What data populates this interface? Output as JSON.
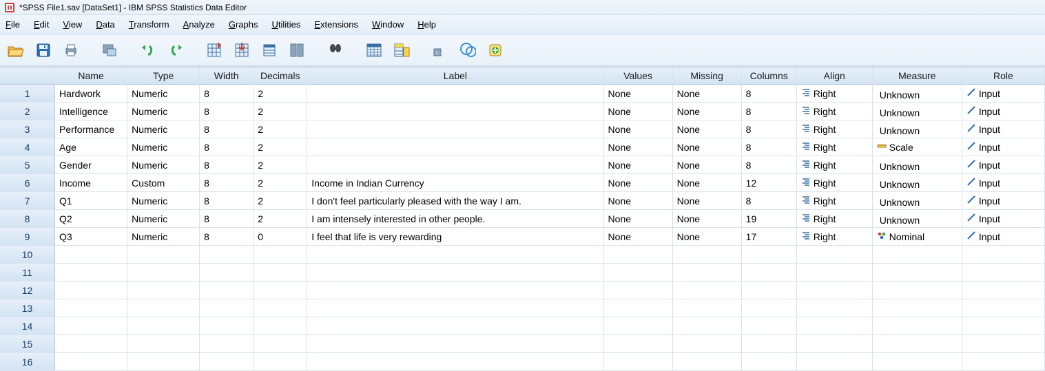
{
  "window": {
    "title": "*SPSS File1.sav [DataSet1] - IBM SPSS Statistics Data Editor"
  },
  "menu": {
    "file": "File",
    "edit": "Edit",
    "view": "View",
    "data": "Data",
    "transform": "Transform",
    "analyze": "Analyze",
    "graphs": "Graphs",
    "utilities": "Utilities",
    "extensions": "Extensions",
    "window": "Window",
    "help": "Help"
  },
  "columns": {
    "name": "Name",
    "type": "Type",
    "width": "Width",
    "decimals": "Decimals",
    "label": "Label",
    "values": "Values",
    "missing": "Missing",
    "cols": "Columns",
    "align": "Align",
    "measure": "Measure",
    "role": "Role"
  },
  "rows": [
    {
      "n": "1",
      "name": "Hardwork",
      "type": "Numeric",
      "width": "8",
      "dec": "2",
      "label": "",
      "values": "None",
      "missing": "None",
      "cols": "8",
      "align": "Right",
      "measure": "Unknown",
      "role": "Input"
    },
    {
      "n": "2",
      "name": "Intelligence",
      "type": "Numeric",
      "width": "8",
      "dec": "2",
      "label": "",
      "values": "None",
      "missing": "None",
      "cols": "8",
      "align": "Right",
      "measure": "Unknown",
      "role": "Input"
    },
    {
      "n": "3",
      "name": "Performance",
      "type": "Numeric",
      "width": "8",
      "dec": "2",
      "label": "",
      "values": "None",
      "missing": "None",
      "cols": "8",
      "align": "Right",
      "measure": "Unknown",
      "role": "Input"
    },
    {
      "n": "4",
      "name": "Age",
      "type": "Numeric",
      "width": "8",
      "dec": "2",
      "label": "",
      "values": "None",
      "missing": "None",
      "cols": "8",
      "align": "Right",
      "measure": "Scale",
      "role": "Input"
    },
    {
      "n": "5",
      "name": "Gender",
      "type": "Numeric",
      "width": "8",
      "dec": "2",
      "label": "",
      "values": "None",
      "missing": "None",
      "cols": "8",
      "align": "Right",
      "measure": "Unknown",
      "role": "Input"
    },
    {
      "n": "6",
      "name": "Income",
      "type": "Custom",
      "width": "8",
      "dec": "2",
      "label": "Income in Indian Currency",
      "values": "None",
      "missing": "None",
      "cols": "12",
      "align": "Right",
      "measure": "Unknown",
      "role": "Input"
    },
    {
      "n": "7",
      "name": "Q1",
      "type": "Numeric",
      "width": "8",
      "dec": "2",
      "label": "I don't feel particularly pleased with the way I am.",
      "values": "None",
      "missing": "None",
      "cols": "8",
      "align": "Right",
      "measure": "Unknown",
      "role": "Input"
    },
    {
      "n": "8",
      "name": "Q2",
      "type": "Numeric",
      "width": "8",
      "dec": "2",
      "label": "I am intensely interested in other people.",
      "values": "None",
      "missing": "None",
      "cols": "19",
      "align": "Right",
      "measure": "Unknown",
      "role": "Input"
    },
    {
      "n": "9",
      "name": "Q3",
      "type": "Numeric",
      "width": "8",
      "dec": "0",
      "label": "I feel that life is very rewarding",
      "values": "None",
      "missing": "None",
      "cols": "17",
      "align": "Right",
      "measure": "Nominal",
      "role": "Input"
    },
    {
      "n": "10"
    },
    {
      "n": "11"
    },
    {
      "n": "12"
    },
    {
      "n": "13"
    },
    {
      "n": "14"
    },
    {
      "n": "15"
    },
    {
      "n": "16"
    }
  ]
}
